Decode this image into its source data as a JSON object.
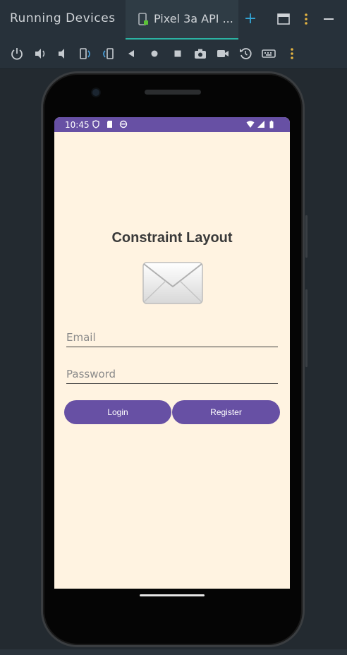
{
  "panel": {
    "title": "Running Devices"
  },
  "tabs": [
    {
      "label": "Pixel 3a API ...",
      "active": true
    }
  ],
  "tab_actions": {
    "add_symbol": "+"
  },
  "toolbar": {
    "icons": [
      "power-icon",
      "volume-up-icon",
      "volume-down-icon",
      "rotate-left-icon",
      "rotate-right-icon",
      "back-icon",
      "home-icon",
      "overview-icon",
      "screenshot-icon",
      "screen-record-icon",
      "reset-icon",
      "keyboard-icon",
      "more-icon"
    ]
  },
  "device": {
    "status_bar": {
      "time": "10:45"
    },
    "app": {
      "heading": "Constraint Layout",
      "email_placeholder": "Email",
      "password_placeholder": "Password",
      "login_label": "Login",
      "register_label": "Register"
    }
  },
  "colors": {
    "accent": "#6750a4",
    "screen_bg": "#fff3e1",
    "tab_accent": "#2bb3a3",
    "add_blue": "#33a6d6",
    "more_yellow": "#e3b341"
  }
}
